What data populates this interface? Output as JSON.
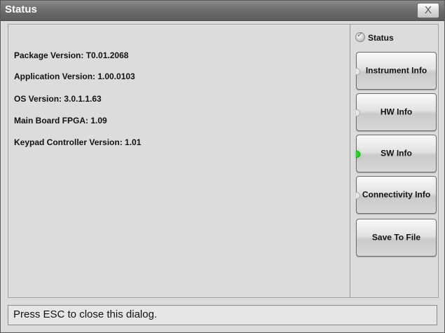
{
  "window": {
    "title": "Status",
    "close_label": "X"
  },
  "info_lines": [
    "Package Version: T0.01.2068",
    "Application Version: 1.00.0103",
    "OS Version: 3.0.1.1.63",
    "Main Board FPGA: 1.09",
    "Keypad Controller Version: 1.01"
  ],
  "sidebar": {
    "status_radio_label": "Status",
    "buttons": [
      {
        "label": "Instrument Info",
        "active": false
      },
      {
        "label": "HW Info",
        "active": false
      },
      {
        "label": "SW Info",
        "active": true
      },
      {
        "label": "Connectivity Info",
        "active": false
      },
      {
        "label": "Save To File"
      }
    ]
  },
  "statusbar": {
    "message": "Press ESC to close this dialog."
  },
  "colors": {
    "active_led": "#33cc33",
    "titlebar": "#6a6a6a"
  }
}
